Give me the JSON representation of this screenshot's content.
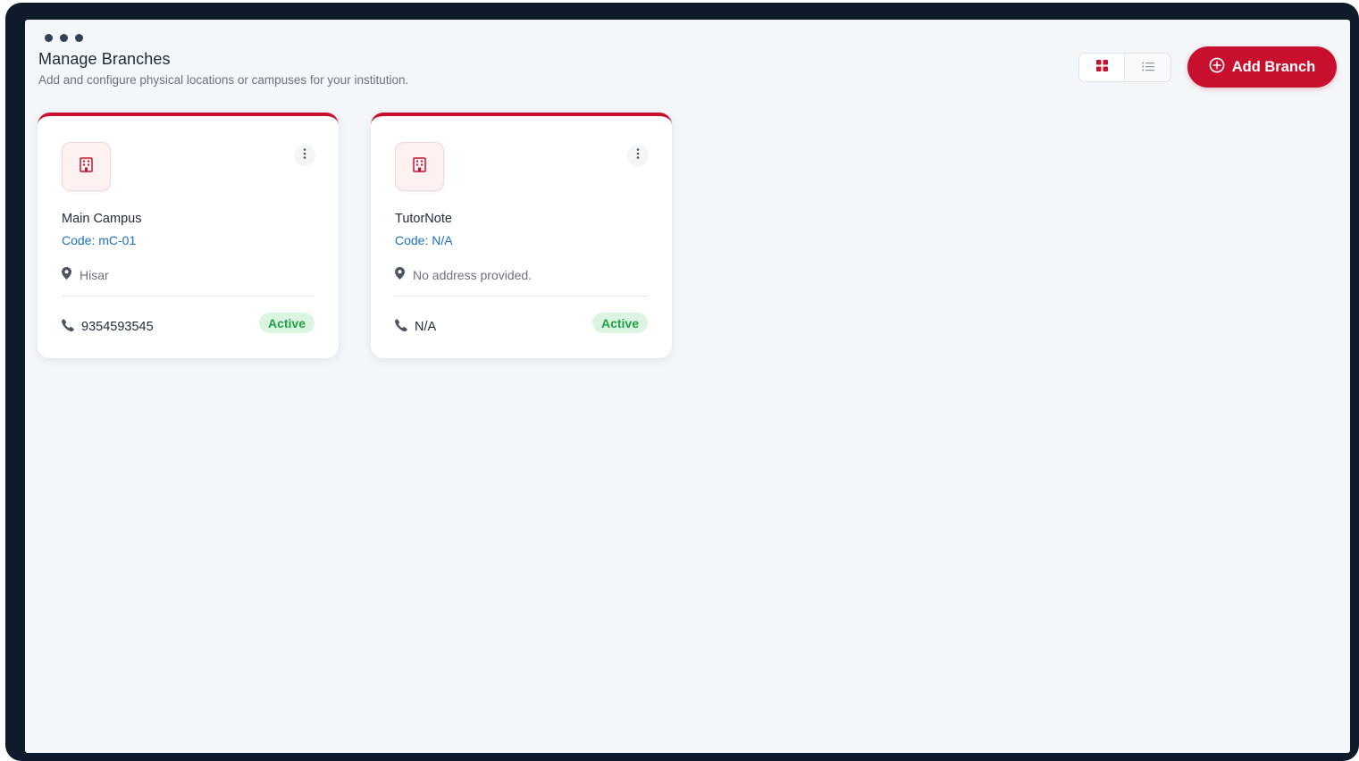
{
  "header": {
    "title": "Manage Branches",
    "subtitle": "Add and configure physical locations or campuses for your institution."
  },
  "toolbar": {
    "view_grid_icon": "grid-icon",
    "view_list_icon": "list-icon",
    "active_view": "grid",
    "add_button_label": "Add Branch",
    "add_button_icon": "plus-circle-icon"
  },
  "colors": {
    "accent": "#c8102e",
    "link": "#1d6fbf",
    "status_active_bg": "#dcf5e2",
    "status_active_text": "#22a045"
  },
  "branches": [
    {
      "icon": "building-icon",
      "name": "Main Campus",
      "code": "Code: mC-01",
      "address": "Hisar",
      "phone": "9354593545",
      "status": "Active"
    },
    {
      "icon": "building-icon",
      "name": "TutorNote",
      "code": "Code: N/A",
      "address": "No address provided.",
      "phone": "N/A",
      "status": "Active"
    }
  ]
}
